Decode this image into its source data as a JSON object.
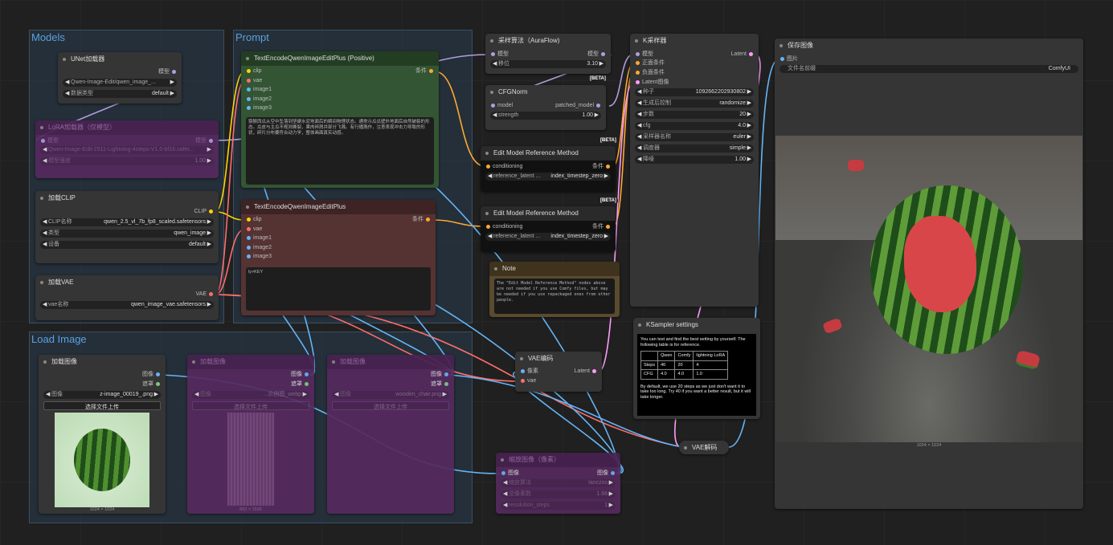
{
  "groups": {
    "models": "Models",
    "prompt": "Prompt",
    "load_image": "Load Image"
  },
  "unet": {
    "title": "UNet加载器",
    "out": "模型",
    "name": "Qwen-Image-Edit/qwen_image_...",
    "dtype_label": "数据类型",
    "dtype": "default"
  },
  "lora": {
    "title": "LoRA加载器（仅模型）",
    "in": "模型",
    "out": "模型",
    "name": "Qwen-Image-Edit-2511-Lightning-4steps-V1.0-bf16.safet...",
    "strength_label": "模型强度",
    "strength": "1.00"
  },
  "clip": {
    "title": "加载CLIP",
    "out": "CLIP",
    "name_label": "CLIP名称",
    "name": "qwen_2.5_vl_7b_fp8_scaled.safetensors",
    "type_label": "类型",
    "type": "qwen_image",
    "device_label": "设备",
    "device": "default"
  },
  "vae": {
    "title": "加载VAE",
    "out": "VAE",
    "name_label": "vae名称",
    "name": "qwen_image_vae.safetensors"
  },
  "pos": {
    "title": "TextEncodeQwenImageEditPlus (Positive)",
    "inputs": [
      "clip",
      "vae",
      "image1",
      "image2",
      "image3"
    ],
    "out": "条件",
    "text": "猕猴西瓜从空中坠落到坚硬水泥地面后的瞬间物理状态。通常示瓜瓜壁外地面后自然破裂的形态。瓜皮与主瓜不规则撕裂，果肉碎屑并部分飞溅。有行播溅作，注意表现冲击力导致的形状，碎片分布要符合动力学，整体画面真实动感。"
  },
  "neg": {
    "title": "TextEncodeQwenImageEditPlus",
    "inputs": [
      "clip",
      "vae",
      "image1",
      "image2",
      "image3"
    ],
    "out": "条件",
    "text": "ly>KEY"
  },
  "sampling": {
    "title": "采样算法（AuraFlow)",
    "in": "模型",
    "out": "模型",
    "shift_label": "移位",
    "shift": "3.10",
    "badge": "[BETA]"
  },
  "cfgnorm": {
    "title": "CFGNorm",
    "in": "model",
    "out": "patched_model",
    "strength_label": "strength",
    "strength": "1.00",
    "badge": "[BETA]"
  },
  "ref1": {
    "title": "Edit Model Reference Method",
    "in": "conditioning",
    "out": "条件",
    "label": "reference_latent ...",
    "value": "index_timestep_zero",
    "badge": "[BETA]"
  },
  "ref2": {
    "title": "Edit Model Reference Method",
    "in": "conditioning",
    "out": "条件",
    "label": "reference_latent ...",
    "value": "index_timestep_zero"
  },
  "note": {
    "title": "Note",
    "text": "The \"Edit Model Reference Method\" nodes above are not needed if you use Comfy files, but may be needed if you use repackaged ones from other people."
  },
  "ksampler": {
    "title": "K采样器",
    "inputs": [
      "模型",
      "正面条件",
      "负面条件",
      "Latent图像"
    ],
    "out": "Latent",
    "widgets": [
      {
        "label": "种子",
        "value": "1092662202930802"
      },
      {
        "label": "生成后控制",
        "value": "randomize"
      },
      {
        "label": "步数",
        "value": "20"
      },
      {
        "label": "cfg",
        "value": "4.0"
      },
      {
        "label": "采样器名称",
        "value": "euler"
      },
      {
        "label": "调度器",
        "value": "simple"
      },
      {
        "label": "降噪",
        "value": "1.00"
      }
    ]
  },
  "kss": {
    "title": "KSampler settings",
    "intro": "You can test and find the best setting by yourself. The following table is for reference.",
    "headers": [
      "",
      "Qwen",
      "Comfy",
      "lightning LoRA"
    ],
    "rows": [
      [
        "Steps",
        "40",
        "20",
        "4"
      ],
      [
        "CFG",
        "4.0",
        "4.0",
        "1.0"
      ]
    ],
    "footer": "By default, we use 20 steps as we just don't want it to take too long. Try 40 if you want a better result, but it will take longer."
  },
  "save": {
    "title": "保存图像",
    "in": "图片",
    "prefix_label": "文件名前缀",
    "prefix": "ComfyUI",
    "size": "1024 × 1024"
  },
  "load1": {
    "title": "加载图像",
    "out1": "图像",
    "out2": "遮罩",
    "label": "图像",
    "file": "z-image_00019_.png",
    "upload": "选择文件上传",
    "size": "1024 × 1024"
  },
  "load2": {
    "title": "加载图像",
    "out1": "图像",
    "out2": "遮罩",
    "label": "图像",
    "file": "...示例图_webp",
    "upload": "选择文件上传",
    "size": "862 × 1536"
  },
  "load3": {
    "title": "加载图像",
    "out1": "图像",
    "out2": "遮罩",
    "label": "图像",
    "file": "wooden_chair.png",
    "upload": "选择文件上传"
  },
  "vaeenc": {
    "title": "VAE编码",
    "in1": "像素",
    "in2": "vae",
    "out": "Latent"
  },
  "vaedec": {
    "title": "VAE解码"
  },
  "scale": {
    "title": "缩放图像（像素）",
    "in": "图像",
    "out": "图像",
    "w1_label": "缩放算法",
    "w1": "lanczos",
    "w2_label": "总像素数",
    "w2": "1.66",
    "w3_label": "resolution_steps",
    "w3": "1"
  },
  "colors": {
    "model": "#b39ddb",
    "clip": "#ffd500",
    "vae": "#ff6e6e",
    "cond": "#ffa931",
    "latent": "#ff9cf9",
    "image": "#64b5f6",
    "mask": "#81c784"
  }
}
